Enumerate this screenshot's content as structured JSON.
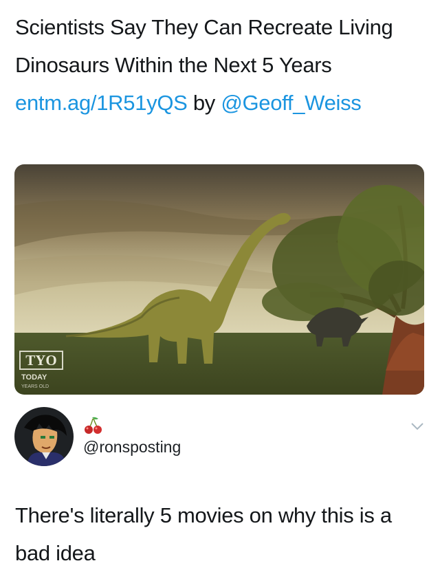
{
  "tweet": {
    "text_before_link": "Scientists Say They Can Recreate Living Dinosaurs Within the Next 5 Years ",
    "link": "entm.ag/1R51yQS",
    "by": " by ",
    "mention": "@Geoff_Weiss"
  },
  "media": {
    "watermark_logo": "TYO",
    "watermark_brand": "TODAY",
    "watermark_sub": "YEARS OLD"
  },
  "reply": {
    "handle": "@ronsposting",
    "emoji": "cherries-icon",
    "text": "There's literally 5 movies on why this is a bad idea"
  },
  "colors": {
    "link": "#1b95e0",
    "text": "#14171a",
    "chevron": "#aab8c2"
  }
}
